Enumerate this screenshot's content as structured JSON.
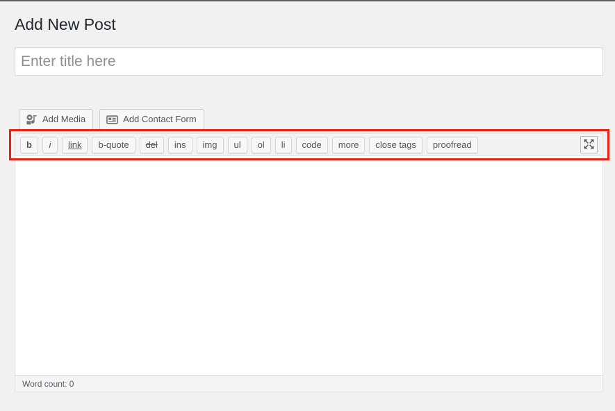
{
  "page": {
    "title": "Add New Post"
  },
  "title_field": {
    "value": "",
    "placeholder": "Enter title here"
  },
  "media_buttons": [
    {
      "label": "Add Media",
      "icon": "media-icon"
    },
    {
      "label": "Add Contact Form",
      "icon": "contact-form-icon"
    }
  ],
  "quicktags": {
    "buttons": [
      {
        "label": "b",
        "style": "bold"
      },
      {
        "label": "i",
        "style": "ital"
      },
      {
        "label": "link",
        "style": "link"
      },
      {
        "label": "b-quote",
        "style": ""
      },
      {
        "label": "del",
        "style": "del"
      },
      {
        "label": "ins",
        "style": ""
      },
      {
        "label": "img",
        "style": ""
      },
      {
        "label": "ul",
        "style": ""
      },
      {
        "label": "ol",
        "style": ""
      },
      {
        "label": "li",
        "style": ""
      },
      {
        "label": "code",
        "style": ""
      },
      {
        "label": "more",
        "style": ""
      },
      {
        "label": "close tags",
        "style": ""
      },
      {
        "label": "proofread",
        "style": ""
      }
    ],
    "fullscreen_icon": "fullscreen-expand-icon"
  },
  "editor": {
    "content": "",
    "word_count_label": "Word count: 0"
  },
  "highlight": {
    "color": "#e82214"
  },
  "colors": {
    "page_background": "#f1f1f1",
    "panel_background": "#ffffff",
    "toolbar_background": "#f3f3f3",
    "footer_background": "#f5f5f5",
    "border": "#dddddd",
    "text": "#32373c",
    "muted_text": "#8f8f8f"
  }
}
